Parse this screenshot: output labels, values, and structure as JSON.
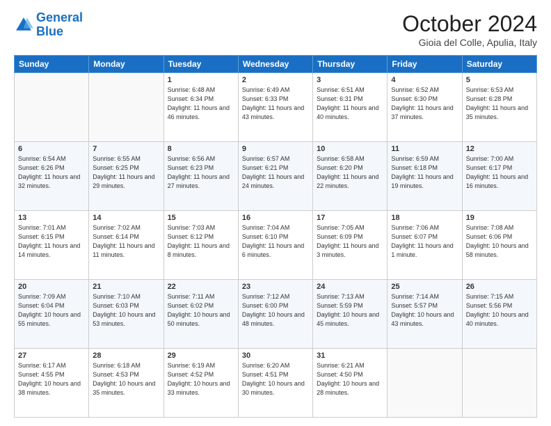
{
  "header": {
    "logo_line1": "General",
    "logo_line2": "Blue",
    "month": "October 2024",
    "location": "Gioia del Colle, Apulia, Italy"
  },
  "weekdays": [
    "Sunday",
    "Monday",
    "Tuesday",
    "Wednesday",
    "Thursday",
    "Friday",
    "Saturday"
  ],
  "weeks": [
    [
      null,
      null,
      {
        "day": 1,
        "sunrise": "6:48 AM",
        "sunset": "6:34 PM",
        "daylight": "11 hours and 46 minutes."
      },
      {
        "day": 2,
        "sunrise": "6:49 AM",
        "sunset": "6:33 PM",
        "daylight": "11 hours and 43 minutes."
      },
      {
        "day": 3,
        "sunrise": "6:51 AM",
        "sunset": "6:31 PM",
        "daylight": "11 hours and 40 minutes."
      },
      {
        "day": 4,
        "sunrise": "6:52 AM",
        "sunset": "6:30 PM",
        "daylight": "11 hours and 37 minutes."
      },
      {
        "day": 5,
        "sunrise": "6:53 AM",
        "sunset": "6:28 PM",
        "daylight": "11 hours and 35 minutes."
      }
    ],
    [
      {
        "day": 6,
        "sunrise": "6:54 AM",
        "sunset": "6:26 PM",
        "daylight": "11 hours and 32 minutes."
      },
      {
        "day": 7,
        "sunrise": "6:55 AM",
        "sunset": "6:25 PM",
        "daylight": "11 hours and 29 minutes."
      },
      {
        "day": 8,
        "sunrise": "6:56 AM",
        "sunset": "6:23 PM",
        "daylight": "11 hours and 27 minutes."
      },
      {
        "day": 9,
        "sunrise": "6:57 AM",
        "sunset": "6:21 PM",
        "daylight": "11 hours and 24 minutes."
      },
      {
        "day": 10,
        "sunrise": "6:58 AM",
        "sunset": "6:20 PM",
        "daylight": "11 hours and 22 minutes."
      },
      {
        "day": 11,
        "sunrise": "6:59 AM",
        "sunset": "6:18 PM",
        "daylight": "11 hours and 19 minutes."
      },
      {
        "day": 12,
        "sunrise": "7:00 AM",
        "sunset": "6:17 PM",
        "daylight": "11 hours and 16 minutes."
      }
    ],
    [
      {
        "day": 13,
        "sunrise": "7:01 AM",
        "sunset": "6:15 PM",
        "daylight": "11 hours and 14 minutes."
      },
      {
        "day": 14,
        "sunrise": "7:02 AM",
        "sunset": "6:14 PM",
        "daylight": "11 hours and 11 minutes."
      },
      {
        "day": 15,
        "sunrise": "7:03 AM",
        "sunset": "6:12 PM",
        "daylight": "11 hours and 8 minutes."
      },
      {
        "day": 16,
        "sunrise": "7:04 AM",
        "sunset": "6:10 PM",
        "daylight": "11 hours and 6 minutes."
      },
      {
        "day": 17,
        "sunrise": "7:05 AM",
        "sunset": "6:09 PM",
        "daylight": "11 hours and 3 minutes."
      },
      {
        "day": 18,
        "sunrise": "7:06 AM",
        "sunset": "6:07 PM",
        "daylight": "11 hours and 1 minute."
      },
      {
        "day": 19,
        "sunrise": "7:08 AM",
        "sunset": "6:06 PM",
        "daylight": "10 hours and 58 minutes."
      }
    ],
    [
      {
        "day": 20,
        "sunrise": "7:09 AM",
        "sunset": "6:04 PM",
        "daylight": "10 hours and 55 minutes."
      },
      {
        "day": 21,
        "sunrise": "7:10 AM",
        "sunset": "6:03 PM",
        "daylight": "10 hours and 53 minutes."
      },
      {
        "day": 22,
        "sunrise": "7:11 AM",
        "sunset": "6:02 PM",
        "daylight": "10 hours and 50 minutes."
      },
      {
        "day": 23,
        "sunrise": "7:12 AM",
        "sunset": "6:00 PM",
        "daylight": "10 hours and 48 minutes."
      },
      {
        "day": 24,
        "sunrise": "7:13 AM",
        "sunset": "5:59 PM",
        "daylight": "10 hours and 45 minutes."
      },
      {
        "day": 25,
        "sunrise": "7:14 AM",
        "sunset": "5:57 PM",
        "daylight": "10 hours and 43 minutes."
      },
      {
        "day": 26,
        "sunrise": "7:15 AM",
        "sunset": "5:56 PM",
        "daylight": "10 hours and 40 minutes."
      }
    ],
    [
      {
        "day": 27,
        "sunrise": "6:17 AM",
        "sunset": "4:55 PM",
        "daylight": "10 hours and 38 minutes."
      },
      {
        "day": 28,
        "sunrise": "6:18 AM",
        "sunset": "4:53 PM",
        "daylight": "10 hours and 35 minutes."
      },
      {
        "day": 29,
        "sunrise": "6:19 AM",
        "sunset": "4:52 PM",
        "daylight": "10 hours and 33 minutes."
      },
      {
        "day": 30,
        "sunrise": "6:20 AM",
        "sunset": "4:51 PM",
        "daylight": "10 hours and 30 minutes."
      },
      {
        "day": 31,
        "sunrise": "6:21 AM",
        "sunset": "4:50 PM",
        "daylight": "10 hours and 28 minutes."
      },
      null,
      null
    ]
  ]
}
